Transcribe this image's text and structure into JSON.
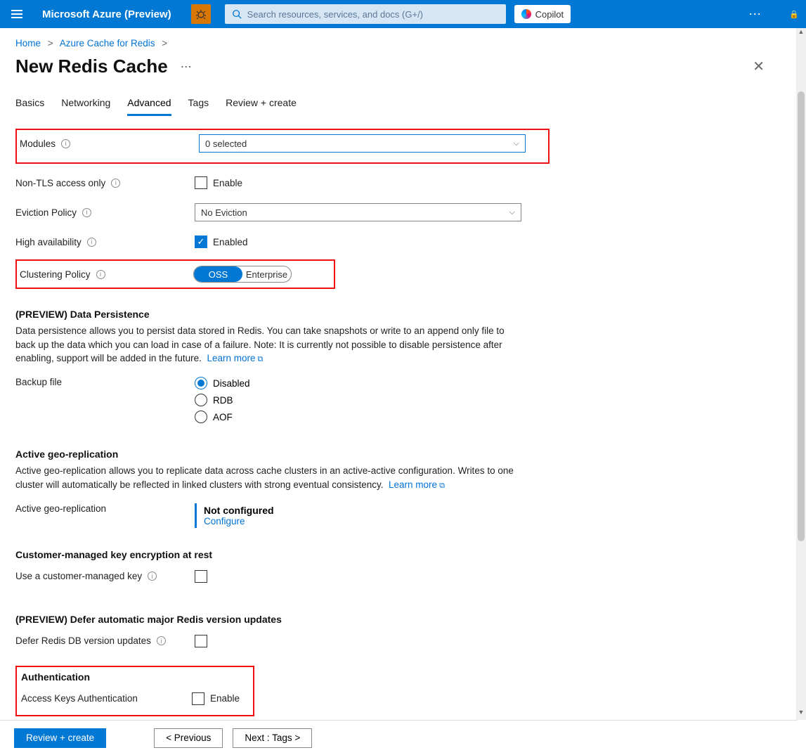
{
  "top": {
    "brand": "Microsoft Azure (Preview)",
    "search_placeholder": "Search resources, services, and docs (G+/)",
    "copilot": "Copilot"
  },
  "breadcrumb": {
    "home": "Home",
    "bc2": "Azure Cache for Redis"
  },
  "page": {
    "title": "New Redis Cache"
  },
  "tabs": [
    "Basics",
    "Networking",
    "Advanced",
    "Tags",
    "Review + create"
  ],
  "active_tab": "Advanced",
  "fields": {
    "modules_label": "Modules",
    "modules_value": "0 selected",
    "nontls_label": "Non-TLS access only",
    "nontls_cb": "Enable",
    "eviction_label": "Eviction Policy",
    "eviction_value": "No Eviction",
    "ha_label": "High availability",
    "ha_cb": "Enabled",
    "cluster_label": "Clustering Policy",
    "cluster_oss": "OSS",
    "cluster_ent": "Enterprise"
  },
  "persistence": {
    "header": "(PREVIEW) Data Persistence",
    "desc": "Data persistence allows you to persist data stored in Redis. You can take snapshots or write to an append only file to back up the data which you can load in case of a failure. Note: It is currently not possible to disable persistence after enabling, support will be added in the future.",
    "learn": "Learn more",
    "backup_label": "Backup file",
    "opts": [
      "Disabled",
      "RDB",
      "AOF"
    ],
    "selected": "Disabled"
  },
  "geo": {
    "header": "Active geo-replication",
    "desc": "Active geo-replication allows you to replicate data across cache clusters in an active-active configuration. Writes to one cluster will automatically be reflected in linked clusters with strong eventual consistency.",
    "learn": "Learn more",
    "row_label": "Active geo-replication",
    "not_configured": "Not configured",
    "configure": "Configure"
  },
  "cmk": {
    "header": "Customer-managed key encryption at rest",
    "row_label": "Use a customer-managed key"
  },
  "defer": {
    "header": "(PREVIEW) Defer automatic major Redis version updates",
    "row_label": "Defer Redis DB version updates"
  },
  "auth": {
    "header": "Authentication",
    "row_label": "Access Keys Authentication",
    "cb": "Enable"
  },
  "footer": {
    "review": "Review + create",
    "prev": "< Previous",
    "next": "Next : Tags >"
  }
}
